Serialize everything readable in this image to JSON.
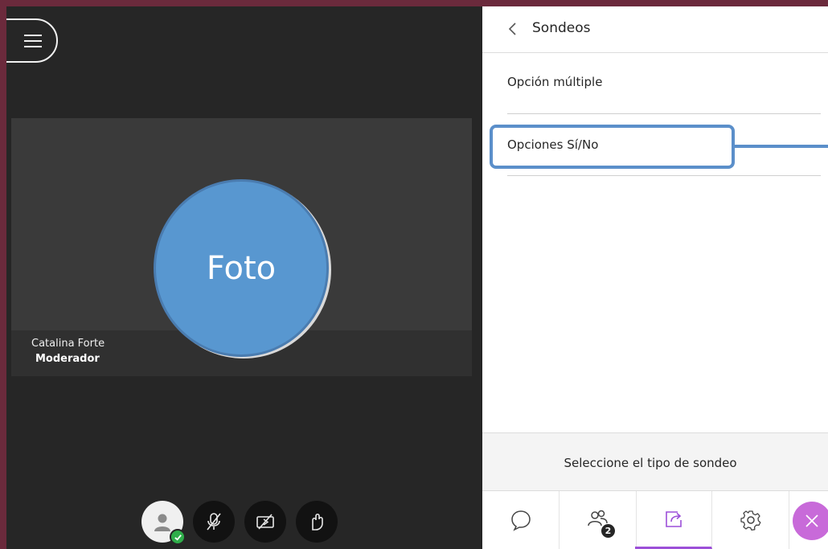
{
  "stage": {
    "participant": {
      "photo_label": "Foto",
      "name": "Catalina Forte",
      "role": "Moderador"
    },
    "controls": [
      {
        "icon": "avatar-icon",
        "status": "connected"
      },
      {
        "icon": "mic-off-icon"
      },
      {
        "icon": "camera-off-icon"
      },
      {
        "icon": "hand-raise-icon"
      }
    ]
  },
  "panel": {
    "title": "Sondeos",
    "options": [
      {
        "label": "Opción múltiple"
      },
      {
        "label": "Opciones Sí/No"
      }
    ],
    "footer_text": "Seleccione el tipo de sondeo",
    "tabs": {
      "attendees_count": "2"
    }
  },
  "colors": {
    "frame": "#6b2a3c",
    "stage_bg": "#262626",
    "photo": "#5897d0",
    "highlight": "#5b8fca",
    "active_tab": "#9c4fd8",
    "close_button": "#c86ad9"
  }
}
